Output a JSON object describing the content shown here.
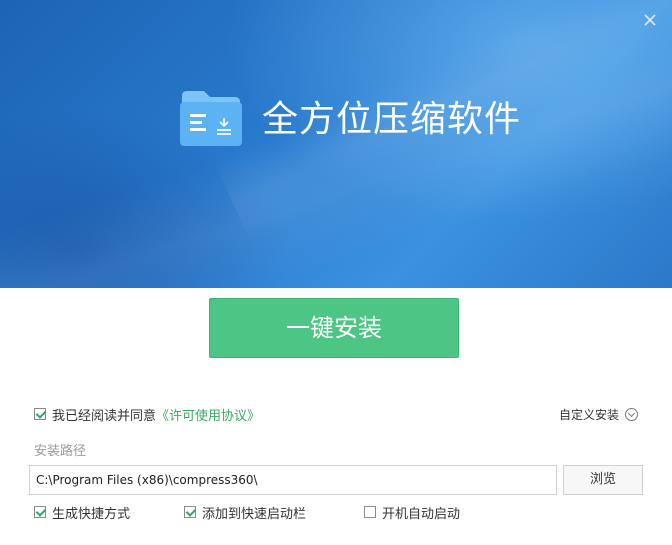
{
  "window": {
    "app_title": "全方位压缩软件",
    "close_icon": "close-icon",
    "logo_icon": "folder-compress-icon"
  },
  "main": {
    "install_label": "一键安装",
    "agree_prefix": "我已经阅读并同意",
    "agree_link": "《许可使用协议》",
    "agree_checked": true,
    "custom_install_label": "自定义安装",
    "path_label": "安装路径",
    "path_value": "C:\\Program Files (x86)\\compress360\\",
    "browse_label": "浏览"
  },
  "options": [
    {
      "label": "生成快捷方式",
      "checked": true
    },
    {
      "label": "添加到快速启动栏",
      "checked": true
    },
    {
      "label": "开机自动启动",
      "checked": false
    }
  ],
  "colors": {
    "banner": "#2a7cd0",
    "install_button": "#4cc585",
    "link": "#3aaa62",
    "check": "#2ca66a"
  }
}
